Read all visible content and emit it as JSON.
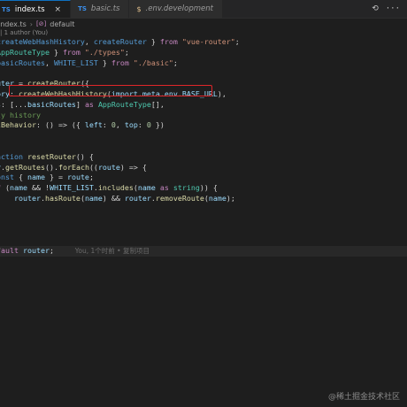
{
  "tabs": [
    {
      "badge": "TS",
      "label": "index.ts",
      "active": true,
      "close": "×"
    },
    {
      "badge": "TS",
      "label": "basic.ts",
      "active": false
    },
    {
      "badge": "$",
      "label": ".env.development",
      "active": false
    }
  ],
  "tab_controls": {
    "compare": "⟲",
    "more": "···"
  },
  "breadcrumb": {
    "file": "index.ts",
    "sep": "›",
    "symbol_badge": "[⊘]",
    "symbol": "default"
  },
  "codelens": "| 1 author (You)",
  "code_lines": [
    [
      [
        "kw2",
        "createWebHashHistory"
      ],
      [
        "plain",
        ", "
      ],
      [
        "kw2",
        "createRouter "
      ],
      [
        "plain",
        "} "
      ],
      [
        "kw",
        "from "
      ],
      [
        "str",
        "\"vue-router\""
      ],
      [
        "plain",
        ";"
      ]
    ],
    [
      [
        "ty",
        "AppRouteType "
      ],
      [
        "plain",
        "} "
      ],
      [
        "kw",
        "from "
      ],
      [
        "str",
        "\"./types\""
      ],
      [
        "plain",
        ";"
      ]
    ],
    [
      [
        "kw2",
        "basicRoutes"
      ],
      [
        "plain",
        ", "
      ],
      [
        "kw2",
        "WHITE_LIST "
      ],
      [
        "plain",
        "} "
      ],
      [
        "kw",
        "from "
      ],
      [
        "str",
        "\"./basic\""
      ],
      [
        "plain",
        ";"
      ]
    ],
    [],
    [
      [
        "var",
        "uter "
      ],
      [
        "plain",
        "= "
      ],
      [
        "fn",
        "createRouter"
      ],
      [
        "plain",
        "({"
      ]
    ],
    [
      [
        "var",
        "ory"
      ],
      [
        "plain",
        ": "
      ],
      [
        "fn",
        "createWebHashHistory"
      ],
      [
        "plain",
        "("
      ],
      [
        "var",
        "import"
      ],
      [
        "plain",
        "."
      ],
      [
        "var",
        "meta"
      ],
      [
        "plain",
        "."
      ],
      [
        "var",
        "env"
      ],
      [
        "plain",
        "."
      ],
      [
        "var",
        "BASE_URL"
      ],
      [
        "plain",
        "),"
      ]
    ],
    [
      [
        "var",
        "s"
      ],
      [
        "plain",
        ": [..."
      ],
      [
        "var",
        "basicRoutes"
      ],
      [
        "plain",
        "] "
      ],
      [
        "kw",
        "as "
      ],
      [
        "ty",
        "AppRouteType"
      ],
      [
        "plain",
        "[],"
      ]
    ],
    [
      [
        "cm",
        "ly history"
      ]
    ],
    [
      [
        "fn",
        "lBehavior"
      ],
      [
        "plain",
        ": () => ({ "
      ],
      [
        "var",
        "left"
      ],
      [
        "plain",
        ": "
      ],
      [
        "num",
        "0"
      ],
      [
        "plain",
        ", "
      ],
      [
        "var",
        "top"
      ],
      [
        "plain",
        ": "
      ],
      [
        "num",
        "0 "
      ],
      [
        "plain",
        "})"
      ]
    ],
    [],
    [],
    [
      [
        "kw2",
        "nction "
      ],
      [
        "fn",
        "resetRouter"
      ],
      [
        "plain",
        "() {"
      ]
    ],
    [
      [
        "var",
        "r"
      ],
      [
        "plain",
        "."
      ],
      [
        "fn",
        "getRoutes"
      ],
      [
        "plain",
        "()."
      ],
      [
        "fn",
        "forEach"
      ],
      [
        "plain",
        "(("
      ],
      [
        "var",
        "route"
      ],
      [
        "plain",
        ") => {"
      ]
    ],
    [
      [
        "kw2",
        "onst "
      ],
      [
        "plain",
        "{ "
      ],
      [
        "var",
        "name "
      ],
      [
        "plain",
        "} = "
      ],
      [
        "var",
        "route"
      ],
      [
        "plain",
        ";"
      ]
    ],
    [
      [
        "kw",
        "f "
      ],
      [
        "plain",
        "("
      ],
      [
        "var",
        "name "
      ],
      [
        "plain",
        "&& !"
      ],
      [
        "var",
        "WHITE_LIST"
      ],
      [
        "plain",
        "."
      ],
      [
        "fn",
        "includes"
      ],
      [
        "plain",
        "("
      ],
      [
        "var",
        "name "
      ],
      [
        "kw",
        "as "
      ],
      [
        "ty",
        "string"
      ],
      [
        "plain",
        ")) {"
      ]
    ],
    [
      [
        "plain",
        "    "
      ],
      [
        "var",
        "router"
      ],
      [
        "plain",
        "."
      ],
      [
        "fn",
        "hasRoute"
      ],
      [
        "plain",
        "("
      ],
      [
        "var",
        "name"
      ],
      [
        "plain",
        ") && "
      ],
      [
        "var",
        "router"
      ],
      [
        "plain",
        "."
      ],
      [
        "fn",
        "removeRoute"
      ],
      [
        "plain",
        "("
      ],
      [
        "var",
        "name"
      ],
      [
        "plain",
        ");"
      ]
    ],
    [],
    [],
    [],
    [],
    [
      [
        "kw",
        "fault "
      ],
      [
        "var",
        "router"
      ],
      [
        "plain",
        ";"
      ],
      [
        "blame",
        "          You, 1个时前 • 复制项目"
      ]
    ]
  ],
  "watermark": "@稀土掘金技术社区"
}
